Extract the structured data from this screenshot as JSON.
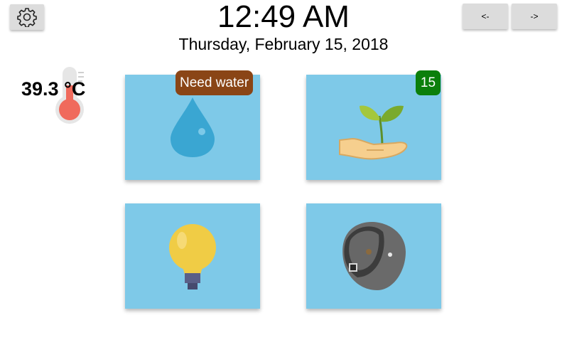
{
  "header": {
    "time": "12:49 AM",
    "date": "Thursday, February 15, 2018",
    "settings_icon": "gear-icon"
  },
  "nav": {
    "prev_label": "<-",
    "next_label": "->"
  },
  "weather": {
    "temperature": "39.3 °C",
    "icon": "thermometer-icon"
  },
  "tiles": {
    "water": {
      "icon": "water-drop-icon",
      "badge": "Need water"
    },
    "plant": {
      "icon": "plant-hand-icon",
      "badge": "15"
    },
    "light": {
      "icon": "light-bulb-icon"
    },
    "camera": {
      "icon": "camera-icon"
    }
  },
  "colors": {
    "tile_background": "#7ec9e8",
    "need_water_badge": "#8a4516",
    "count_badge": "#0b7f0b",
    "button_background": "#dcdcdc"
  }
}
